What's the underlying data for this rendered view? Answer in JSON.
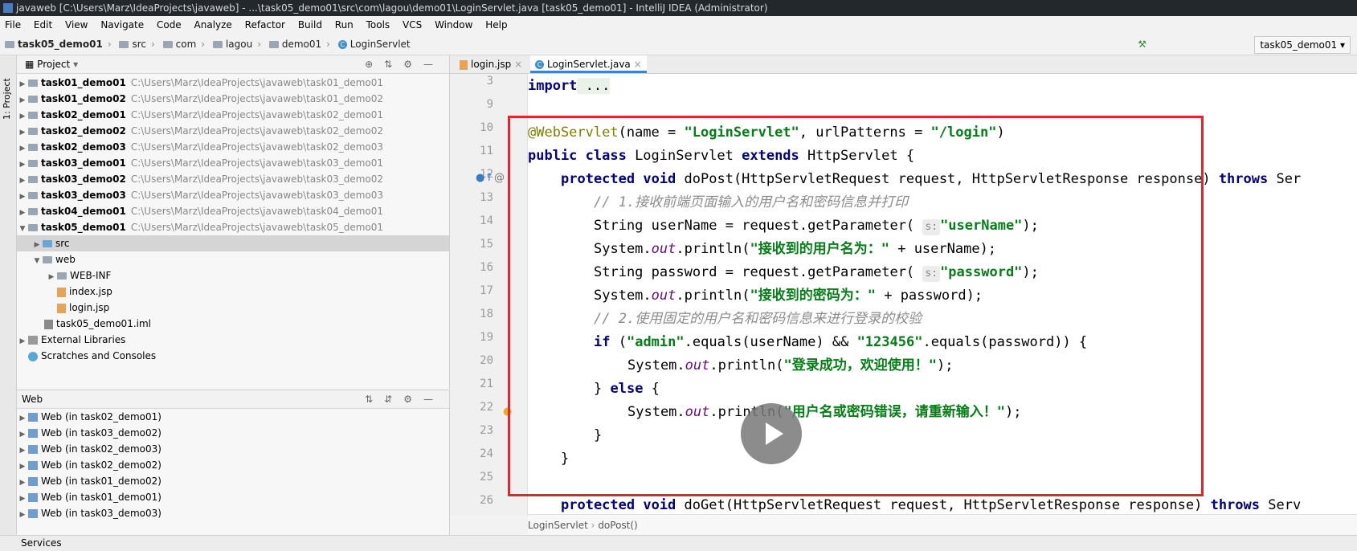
{
  "window": {
    "title": "javaweb [C:\\Users\\Marz\\IdeaProjects\\javaweb] - ...\\task05_demo01\\src\\com\\lagou\\demo01\\LoginServlet.java [task05_demo01] - IntelliJ IDEA (Administrator)"
  },
  "menu": [
    "File",
    "Edit",
    "View",
    "Navigate",
    "Code",
    "Analyze",
    "Refactor",
    "Build",
    "Run",
    "Tools",
    "VCS",
    "Window",
    "Help"
  ],
  "nav": {
    "crumbs": [
      "task05_demo01",
      "src",
      "com",
      "lagou",
      "demo01",
      "LoginServlet"
    ],
    "run_config": "task05_demo01"
  },
  "toolstrip": {
    "project_label": "1: Project"
  },
  "project_panel": {
    "title": "Project",
    "modules": [
      {
        "name": "task01_demo01",
        "path": "C:\\Users\\Marz\\IdeaProjects\\javaweb\\task01_demo01"
      },
      {
        "name": "task01_demo02",
        "path": "C:\\Users\\Marz\\IdeaProjects\\javaweb\\task01_demo02"
      },
      {
        "name": "task02_demo01",
        "path": "C:\\Users\\Marz\\IdeaProjects\\javaweb\\task02_demo01"
      },
      {
        "name": "task02_demo02",
        "path": "C:\\Users\\Marz\\IdeaProjects\\javaweb\\task02_demo02"
      },
      {
        "name": "task02_demo03",
        "path": "C:\\Users\\Marz\\IdeaProjects\\javaweb\\task02_demo03"
      },
      {
        "name": "task03_demo01",
        "path": "C:\\Users\\Marz\\IdeaProjects\\javaweb\\task03_demo01"
      },
      {
        "name": "task03_demo02",
        "path": "C:\\Users\\Marz\\IdeaProjects\\javaweb\\task03_demo02"
      },
      {
        "name": "task03_demo03",
        "path": "C:\\Users\\Marz\\IdeaProjects\\javaweb\\task03_demo03"
      },
      {
        "name": "task04_demo01",
        "path": "C:\\Users\\Marz\\IdeaProjects\\javaweb\\task04_demo01"
      },
      {
        "name": "task05_demo01",
        "path": "C:\\Users\\Marz\\IdeaProjects\\javaweb\\task05_demo01"
      }
    ],
    "children": {
      "src": "src",
      "web": "web",
      "web_inf": "WEB-INF",
      "index": "index.jsp",
      "login": "login.jsp",
      "iml": "task05_demo01.iml",
      "ext_libs": "External Libraries",
      "scratches": "Scratches and Consoles"
    }
  },
  "web_panel": {
    "title": "Web",
    "items": [
      "Web (in task02_demo01)",
      "Web (in task03_demo02)",
      "Web (in task02_demo03)",
      "Web (in task02_demo02)",
      "Web (in task01_demo02)",
      "Web (in task01_demo01)",
      "Web (in task03_demo03)"
    ]
  },
  "editor": {
    "tabs": [
      "login.jsp",
      "LoginServlet.java"
    ],
    "line_numbers": [
      "3",
      "9",
      "10",
      "11",
      "12",
      "13",
      "14",
      "15",
      "16",
      "17",
      "18",
      "19",
      "20",
      "21",
      "22",
      "23",
      "24",
      "25",
      "26"
    ],
    "code": {
      "l3_kw": "import",
      "l3_rest": " ...",
      "l10_ann": "@WebServlet",
      "l10_a": "(name = ",
      "l10_s1": "\"LoginServlet\"",
      "l10_b": ", urlPatterns = ",
      "l10_s2": "\"/login\"",
      "l10_c": ")",
      "l11_kw1": "public class",
      "l11_a": " LoginServlet ",
      "l11_kw2": "extends",
      "l11_b": " HttpServlet {",
      "l12_kw1": "protected void",
      "l12_a": " doPost(HttpServletRequest request, HttpServletResponse response) ",
      "l12_kw2": "throws",
      "l12_b": " Ser",
      "l13_cmt": "// 1.接收前端页面输入的用户名和密码信息并打印",
      "l14_a": "String userName = request.getParameter( ",
      "l14_hint": "s:",
      "l14_s": "\"userName\"",
      "l14_b": ");",
      "l15_a": "System.",
      "l15_fld": "out",
      "l15_b": ".println(",
      "l15_s": "\"接收到的用户名为：\"",
      "l15_c": " + userName);",
      "l16_a": "String password = request.getParameter( ",
      "l16_hint": "s:",
      "l16_s": "\"password\"",
      "l16_b": ");",
      "l17_a": "System.",
      "l17_fld": "out",
      "l17_b": ".println(",
      "l17_s": "\"接收到的密码为：\"",
      "l17_c": " + password);",
      "l18_cmt": "// 2.使用固定的用户名和密码信息来进行登录的校验",
      "l19_kw": "if",
      "l19_a": " (",
      "l19_s1": "\"admin\"",
      "l19_b": ".equals(userName) && ",
      "l19_s2": "\"123456\"",
      "l19_c": ".equals(password)) {",
      "l20_a": "System.",
      "l20_fld": "out",
      "l20_b": ".println(",
      "l20_s": "\"登录成功，欢迎使用！\"",
      "l20_c": ");",
      "l21_a": "} ",
      "l21_kw": "else",
      "l21_b": " {",
      "l22_a": "System.",
      "l22_fld": "out",
      "l22_b": ".println(",
      "l22_s": "\"用户名或密码错误，请重新输入！\"",
      "l22_c": ");",
      "l23": "}",
      "l24": "}",
      "l26_kw": "protected void",
      "l26_a": " doGet(HttpServletRequest request, HttpServletResponse response) ",
      "l26_kw2": "throws",
      "l26_b": " Serv"
    },
    "breadcrumb": [
      "LoginServlet",
      "doPost()"
    ]
  },
  "status": {
    "services_label": "Services"
  },
  "colors": {
    "highlight_box": "#e3262b",
    "active_tab_underline": "#4083c9"
  }
}
